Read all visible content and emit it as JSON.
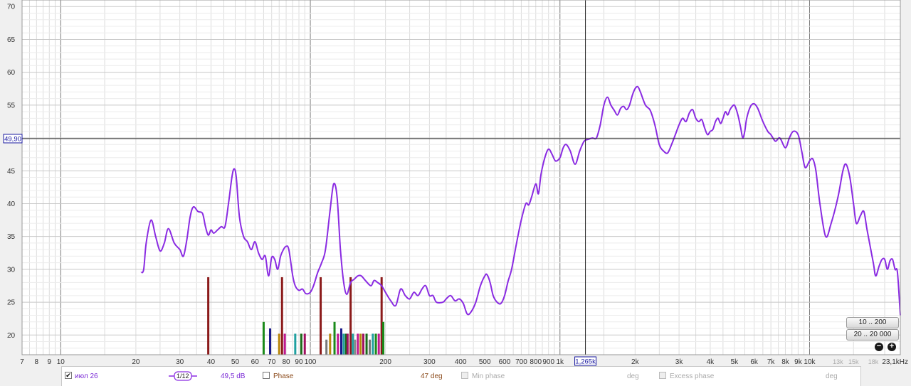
{
  "chart_data": {
    "type": "line",
    "x_scale": "log",
    "x_range": [
      7,
      23100
    ],
    "y_range": [
      17,
      71
    ],
    "x_tick_labels": [
      {
        "x": 7,
        "label": "7"
      },
      {
        "x": 8,
        "label": "8"
      },
      {
        "x": 9,
        "label": "9"
      },
      {
        "x": 10,
        "label": "10"
      },
      {
        "x": 20,
        "label": "20"
      },
      {
        "x": 30,
        "label": "30"
      },
      {
        "x": 40,
        "label": "40"
      },
      {
        "x": 50,
        "label": "50"
      },
      {
        "x": 60,
        "label": "60"
      },
      {
        "x": 70,
        "label": "70"
      },
      {
        "x": 80,
        "label": "80"
      },
      {
        "x": 90,
        "label": "90"
      },
      {
        "x": 100,
        "label": "100"
      },
      {
        "x": 200,
        "label": "200"
      },
      {
        "x": 300,
        "label": "300"
      },
      {
        "x": 400,
        "label": "400"
      },
      {
        "x": 500,
        "label": "500"
      },
      {
        "x": 600,
        "label": "600"
      },
      {
        "x": 700,
        "label": "700"
      },
      {
        "x": 800,
        "label": "800"
      },
      {
        "x": 900,
        "label": "900"
      },
      {
        "x": 1000,
        "label": "1k"
      },
      {
        "x": 2000,
        "label": "2k"
      },
      {
        "x": 3000,
        "label": "3k"
      },
      {
        "x": 4000,
        "label": "4k"
      },
      {
        "x": 5000,
        "label": "5k"
      },
      {
        "x": 6000,
        "label": "6k"
      },
      {
        "x": 7000,
        "label": "7k"
      },
      {
        "x": 8000,
        "label": "8k"
      },
      {
        "x": 9000,
        "label": "9k"
      },
      {
        "x": 10000,
        "label": "10k"
      }
    ],
    "x_tick_labels_light": [
      {
        "x": 13000,
        "label": "13k"
      },
      {
        "x": 15000,
        "label": "15k"
      },
      {
        "x": 18000,
        "label": "18k"
      }
    ],
    "x_end_label": "23,1kHz",
    "y_ticks": [
      20,
      25,
      30,
      35,
      40,
      45,
      50,
      55,
      60,
      65,
      70
    ],
    "cursor": {
      "x": 1265,
      "y": 49.9,
      "x_label": "1,265k",
      "y_label": "49,90"
    },
    "series": [
      {
        "color": "#8a2be2",
        "points": [
          [
            21,
            29.5
          ],
          [
            21.5,
            30
          ],
          [
            22,
            34
          ],
          [
            23,
            37.5
          ],
          [
            24,
            35
          ],
          [
            25,
            32.8
          ],
          [
            26,
            34
          ],
          [
            27,
            36.2
          ],
          [
            28.5,
            34
          ],
          [
            30,
            33
          ],
          [
            31,
            32
          ],
          [
            32,
            34.5
          ],
          [
            33,
            38
          ],
          [
            34,
            39.5
          ],
          [
            35.5,
            38.8
          ],
          [
            37,
            38.5
          ],
          [
            38,
            36.5
          ],
          [
            39,
            35.2
          ],
          [
            40,
            36
          ],
          [
            41,
            35.5
          ],
          [
            42.5,
            36
          ],
          [
            44,
            36.5
          ],
          [
            45.5,
            36.5
          ],
          [
            47,
            40
          ],
          [
            48.5,
            44
          ],
          [
            49.5,
            45.3
          ],
          [
            50.5,
            44
          ],
          [
            52,
            38
          ],
          [
            54,
            35
          ],
          [
            56,
            34.2
          ],
          [
            58,
            33
          ],
          [
            60,
            34.2
          ],
          [
            62,
            32.5
          ],
          [
            64,
            31.5
          ],
          [
            66,
            32
          ],
          [
            68,
            29
          ],
          [
            70,
            31.8
          ],
          [
            72,
            31.5
          ],
          [
            74,
            30
          ],
          [
            76,
            32
          ],
          [
            78,
            33
          ],
          [
            80,
            33.5
          ],
          [
            82,
            33
          ],
          [
            85,
            29
          ],
          [
            87,
            27.5
          ],
          [
            90,
            26.8
          ],
          [
            93,
            27
          ],
          [
            96,
            26.3
          ],
          [
            100,
            26.5
          ],
          [
            103,
            27.5
          ],
          [
            107,
            29.5
          ],
          [
            111,
            31
          ],
          [
            115,
            33
          ],
          [
            120,
            39
          ],
          [
            124,
            43
          ],
          [
            128,
            41
          ],
          [
            132,
            33
          ],
          [
            136,
            28
          ],
          [
            140,
            26.2
          ],
          [
            145,
            28
          ],
          [
            150,
            28.5
          ],
          [
            155,
            29
          ],
          [
            160,
            29
          ],
          [
            167,
            28.2
          ],
          [
            175,
            27.5
          ],
          [
            180,
            28.3
          ],
          [
            186,
            28
          ],
          [
            193,
            27.5
          ],
          [
            200,
            26.5
          ],
          [
            210,
            25.2
          ],
          [
            220,
            24.5
          ],
          [
            230,
            27
          ],
          [
            240,
            26
          ],
          [
            250,
            25.5
          ],
          [
            260,
            26.5
          ],
          [
            270,
            26
          ],
          [
            280,
            27
          ],
          [
            290,
            27.5
          ],
          [
            300,
            26
          ],
          [
            310,
            26
          ],
          [
            320,
            25
          ],
          [
            340,
            25
          ],
          [
            350,
            25.5
          ],
          [
            365,
            26
          ],
          [
            380,
            25.2
          ],
          [
            395,
            25.5
          ],
          [
            410,
            24.8
          ],
          [
            425,
            23.2
          ],
          [
            440,
            23.5
          ],
          [
            460,
            25
          ],
          [
            480,
            27.5
          ],
          [
            500,
            29
          ],
          [
            510,
            29.2
          ],
          [
            525,
            28
          ],
          [
            540,
            26
          ],
          [
            560,
            25
          ],
          [
            580,
            24.8
          ],
          [
            600,
            26
          ],
          [
            620,
            28.2
          ],
          [
            640,
            30
          ],
          [
            670,
            34
          ],
          [
            700,
            37.5
          ],
          [
            730,
            40
          ],
          [
            750,
            39.8
          ],
          [
            770,
            41
          ],
          [
            800,
            43
          ],
          [
            820,
            41.5
          ],
          [
            840,
            44.5
          ],
          [
            870,
            47
          ],
          [
            900,
            48.3
          ],
          [
            930,
            47.5
          ],
          [
            960,
            46.5
          ],
          [
            1000,
            47
          ],
          [
            1030,
            48.5
          ],
          [
            1060,
            49
          ],
          [
            1100,
            48
          ],
          [
            1150,
            46
          ],
          [
            1200,
            48
          ],
          [
            1250,
            49.5
          ],
          [
            1300,
            49.8
          ],
          [
            1350,
            50
          ],
          [
            1400,
            50
          ],
          [
            1450,
            52
          ],
          [
            1500,
            55
          ],
          [
            1550,
            56.2
          ],
          [
            1600,
            55
          ],
          [
            1650,
            54.2
          ],
          [
            1700,
            53.5
          ],
          [
            1750,
            54.5
          ],
          [
            1800,
            54.8
          ],
          [
            1850,
            54.3
          ],
          [
            1900,
            55
          ],
          [
            1950,
            56.5
          ],
          [
            2000,
            57.5
          ],
          [
            2050,
            57.8
          ],
          [
            2100,
            57
          ],
          [
            2200,
            55
          ],
          [
            2300,
            54.2
          ],
          [
            2400,
            52
          ],
          [
            2500,
            49
          ],
          [
            2600,
            48
          ],
          [
            2700,
            47.7
          ],
          [
            2800,
            49
          ],
          [
            2900,
            50.5
          ],
          [
            3000,
            52
          ],
          [
            3100,
            53
          ],
          [
            3200,
            52.5
          ],
          [
            3300,
            53.8
          ],
          [
            3400,
            54.3
          ],
          [
            3500,
            53
          ],
          [
            3600,
            52.5
          ],
          [
            3700,
            52.8
          ],
          [
            3800,
            51.5
          ],
          [
            3900,
            50.5
          ],
          [
            4000,
            51
          ],
          [
            4100,
            51.3
          ],
          [
            4200,
            52.5
          ],
          [
            4300,
            53
          ],
          [
            4400,
            52.2
          ],
          [
            4500,
            53
          ],
          [
            4600,
            54
          ],
          [
            4700,
            53.5
          ],
          [
            4800,
            54.3
          ],
          [
            4900,
            54.8
          ],
          [
            5000,
            55
          ],
          [
            5100,
            54.2
          ],
          [
            5200,
            53
          ],
          [
            5300,
            51.5
          ],
          [
            5400,
            50
          ],
          [
            5500,
            51
          ],
          [
            5600,
            53
          ],
          [
            5800,
            54.8
          ],
          [
            6000,
            55.2
          ],
          [
            6200,
            54.5
          ],
          [
            6500,
            52.5
          ],
          [
            6800,
            51
          ],
          [
            7000,
            50.5
          ],
          [
            7300,
            49.5
          ],
          [
            7600,
            50
          ],
          [
            8000,
            48.5
          ],
          [
            8300,
            50
          ],
          [
            8600,
            51
          ],
          [
            9000,
            50.5
          ],
          [
            9300,
            48
          ],
          [
            9600,
            45.5
          ],
          [
            10000,
            46.5
          ],
          [
            10300,
            46.8
          ],
          [
            10600,
            45
          ],
          [
            11000,
            40
          ],
          [
            11600,
            35
          ],
          [
            12200,
            37
          ],
          [
            13000,
            41
          ],
          [
            13600,
            45
          ],
          [
            14000,
            46
          ],
          [
            14500,
            44
          ],
          [
            15000,
            40
          ],
          [
            15400,
            37
          ],
          [
            16000,
            38.2
          ],
          [
            16500,
            38.8
          ],
          [
            17000,
            36
          ],
          [
            18000,
            31
          ],
          [
            18400,
            29
          ],
          [
            19000,
            30.5
          ],
          [
            19500,
            31.5
          ],
          [
            20000,
            31.5
          ],
          [
            20500,
            30
          ],
          [
            21000,
            31.3
          ],
          [
            21500,
            31.5
          ],
          [
            22000,
            30
          ],
          [
            22500,
            29.5
          ],
          [
            23100,
            23
          ]
        ]
      }
    ],
    "bars": [
      {
        "x": 39,
        "h": 28.8,
        "c": "#8b1a1a"
      },
      {
        "x": 65,
        "h": 22,
        "c": "#1a8a1a"
      },
      {
        "x": 69,
        "h": 21,
        "c": "#1a1a8b"
      },
      {
        "x": 75,
        "h": 20.2,
        "c": "#b8860b"
      },
      {
        "x": 77,
        "h": 28.8,
        "c": "#8b1a1a"
      },
      {
        "x": 79,
        "h": 20.2,
        "c": "#c01890"
      },
      {
        "x": 87,
        "h": 20.2,
        "c": "#20a0a0"
      },
      {
        "x": 92,
        "h": 20.2,
        "c": "#1a6a1a"
      },
      {
        "x": 95,
        "h": 20.2,
        "c": "#a01060"
      },
      {
        "x": 110,
        "h": 28.8,
        "c": "#8b1a1a"
      },
      {
        "x": 116,
        "h": 19.3,
        "c": "#777777"
      },
      {
        "x": 120,
        "h": 20.2,
        "c": "#b8860b"
      },
      {
        "x": 125,
        "h": 22,
        "c": "#1a8a1a"
      },
      {
        "x": 129,
        "h": 20.2,
        "c": "#c01890"
      },
      {
        "x": 133,
        "h": 21,
        "c": "#1a1a8b"
      },
      {
        "x": 136,
        "h": 20.2,
        "c": "#20a0a0"
      },
      {
        "x": 139,
        "h": 20.2,
        "c": "#1a6a1a"
      },
      {
        "x": 141,
        "h": 20.2,
        "c": "#a01060"
      },
      {
        "x": 145,
        "h": 28.8,
        "c": "#8b1a1a"
      },
      {
        "x": 148,
        "h": 20.2,
        "c": "#20a0a0"
      },
      {
        "x": 151,
        "h": 19.3,
        "c": "#888888"
      },
      {
        "x": 155,
        "h": 20.2,
        "c": "#c01890"
      },
      {
        "x": 159,
        "h": 20.2,
        "c": "#b8860b"
      },
      {
        "x": 163,
        "h": 20.2,
        "c": "#a01060"
      },
      {
        "x": 168,
        "h": 20.2,
        "c": "#1a6a1a"
      },
      {
        "x": 173,
        "h": 19.3,
        "c": "#777777"
      },
      {
        "x": 178,
        "h": 20.2,
        "c": "#20a0a0"
      },
      {
        "x": 183,
        "h": 20.2,
        "c": "#1a8a1a"
      },
      {
        "x": 188,
        "h": 20.2,
        "c": "#c01890"
      },
      {
        "x": 193,
        "h": 28.8,
        "c": "#8b1a1a"
      },
      {
        "x": 196,
        "h": 22,
        "c": "#1a8a1a"
      }
    ]
  },
  "range_buttons": {
    "low": "10 .. 200",
    "full": "20 .. 20 000"
  },
  "bottom_panel": {
    "measurement_name": "июл 26",
    "smoothing": "1/12",
    "level": "49,5 dB",
    "phase_label": "Phase",
    "phase_value": "47 deg",
    "min_phase_label": "Min phase",
    "min_phase_unit": "deg",
    "excess_phase_label": "Excess phase",
    "excess_phase_unit": "deg"
  }
}
